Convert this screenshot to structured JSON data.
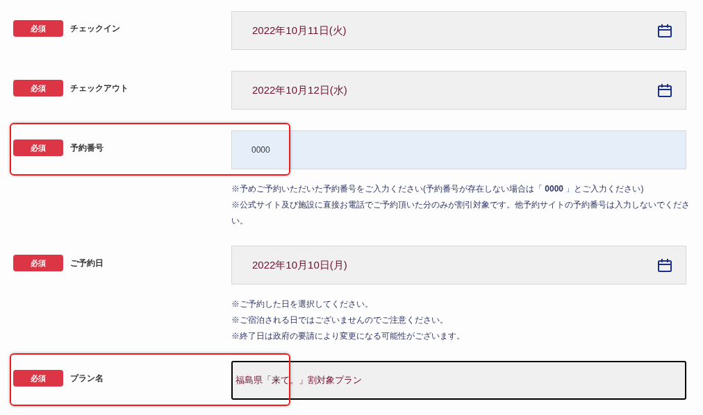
{
  "rows": [
    {
      "badge": "必須",
      "label": "チェックイン",
      "kind": "date",
      "value": "2022年10月11日(火)",
      "highlighted": false
    },
    {
      "badge": "必須",
      "label": "チェックアウト",
      "kind": "date",
      "value": "2022年10月12日(水)",
      "highlighted": false
    },
    {
      "badge": "必須",
      "label": "予約番号",
      "kind": "text",
      "value": "0000",
      "highlighted": true,
      "notes": [
        "※予めご予約いただいた予約番号をご入力ください(予約番号が存在しない場合は「 **0000** 」とご入力ください)",
        "※公式サイト及び施設に直接お電話でご予約頂いた分のみが割引対象です。他予約サイトの予約番号は入力しないでください。"
      ]
    },
    {
      "badge": "必須",
      "label": "ご予約日",
      "kind": "date",
      "value": "2022年10月10日(月)",
      "highlighted": false,
      "notes": [
        "※ご予約した日を選択してください。",
        "※ご宿泊される日ではございませんのでご注意ください。",
        "※終了日は政府の要請により変更になる可能性がございます。"
      ]
    },
    {
      "badge": "必須",
      "label": "プラン名",
      "kind": "select",
      "value": "福島県「来て。」割対象プラン",
      "highlighted": true
    }
  ]
}
